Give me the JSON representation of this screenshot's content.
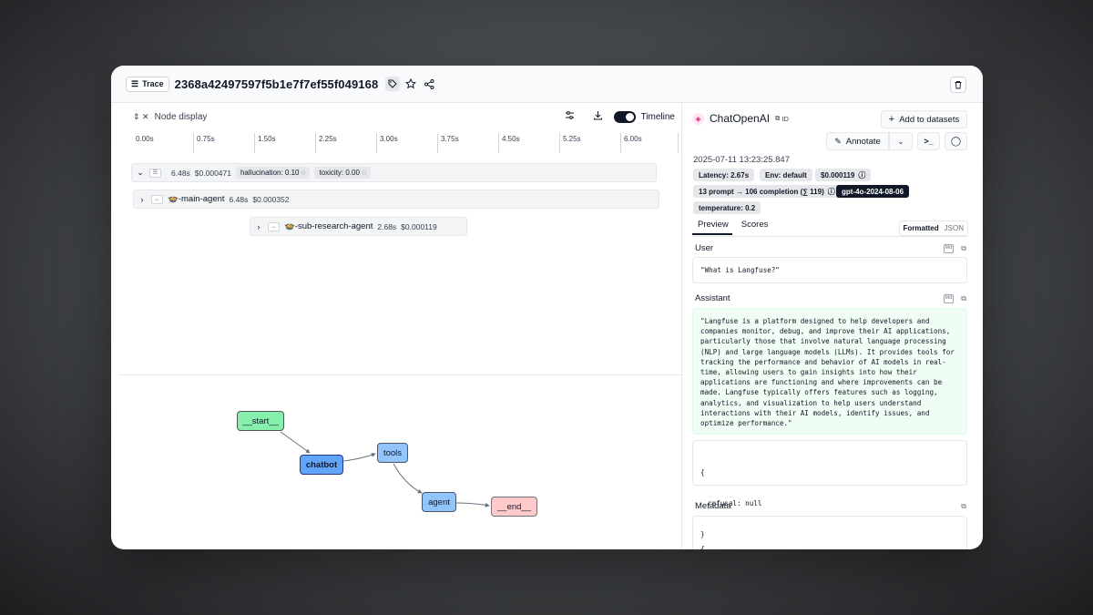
{
  "header": {
    "trace_label": "Trace",
    "trace_id": "2368a42497597f5b1e7f7ef55f049168"
  },
  "toolbar": {
    "node_display_label": "Node display",
    "timeline_label": "Timeline"
  },
  "timeline": {
    "ticks": [
      "0.00s",
      "0.75s",
      "1.50s",
      "2.25s",
      "3.00s",
      "3.75s",
      "4.50s",
      "5.25s",
      "6.00s"
    ],
    "root": {
      "duration": "6.48s",
      "cost": "$0.000471",
      "scores": [
        "hallucination: 0.10",
        "toxicity: 0.00"
      ]
    },
    "main_agent": {
      "name": "🍲-main-agent",
      "duration": "6.48s",
      "cost": "$0.000352"
    },
    "sub_agent": {
      "name": "🍲-sub-research-agent",
      "duration": "2.68s",
      "cost": "$0.000119"
    }
  },
  "graph": {
    "nodes": {
      "start": "__start__",
      "chatbot": "chatbot",
      "tools": "tools",
      "agent": "agent",
      "end": "__end__"
    },
    "colors": {
      "start": "#86efac",
      "chatbot": "#60a5fa",
      "tools": "#93c5fd",
      "agent": "#93c5fd",
      "end": "#fecaca"
    }
  },
  "detail": {
    "title": "ChatOpenAI",
    "id_label": "ID",
    "add_to_datasets": "Add to datasets",
    "annotate": "Annotate",
    "timestamp": "2025-07-11 13:23:25.847",
    "chips": {
      "latency": "Latency: 2.67s",
      "env": "Env: default",
      "cost": "$0.000119",
      "tokens": "13 prompt → 106 completion (∑ 119)",
      "model": "gpt-4o-2024-08-06",
      "temperature": "temperature: 0.2"
    },
    "tabs": [
      "Preview",
      "Scores"
    ],
    "format_options": [
      "Formatted",
      "JSON"
    ],
    "user_label": "User",
    "user_text": "\"What is Langfuse?\"",
    "assistant_label": "Assistant",
    "assistant_text": "\"Langfuse is a platform designed to help developers and companies monitor, debug, and improve their AI applications, particularly those that involve natural language processing (NLP) and large language models (LLMs). It provides tools for tracking the performance and behavior of AI models in real-time, allowing users to gain insights into how their applications are functioning and where improvements can be made. Langfuse typically offers features such as logging, analytics, and visualization to help users understand interactions with their AI models, identify issues, and optimize performance.\"",
    "refusal_open": "{",
    "refusal_line": "refusal: null",
    "refusal_close": "}",
    "metadata_label": "Metadata",
    "metadata_open": "{"
  }
}
